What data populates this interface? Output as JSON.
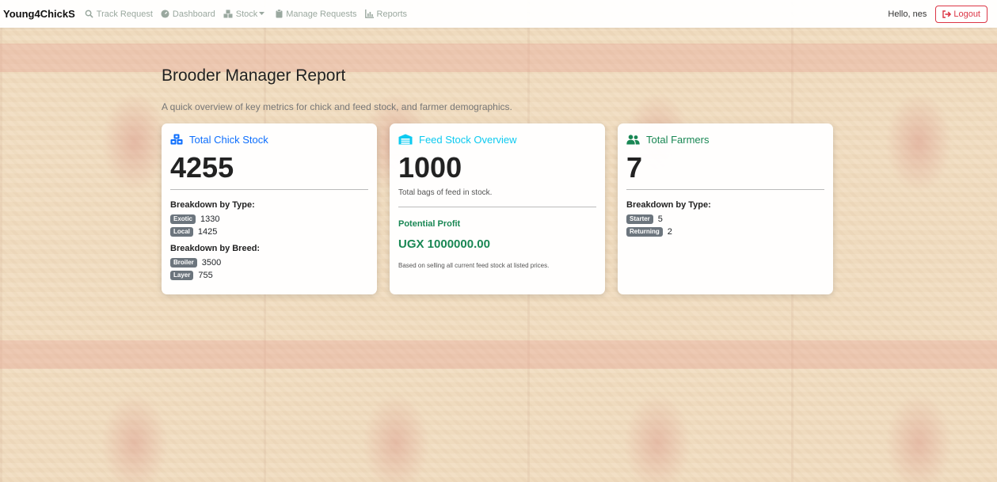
{
  "nav": {
    "brand": "Young4ChickS",
    "items": [
      {
        "label": "Track Request",
        "icon": "search-icon"
      },
      {
        "label": "Dashboard",
        "icon": "dashboard-icon"
      },
      {
        "label": "Stock",
        "icon": "boxes-icon"
      },
      {
        "label": "Manage Requests",
        "icon": "clipboard-icon"
      },
      {
        "label": "Reports",
        "icon": "chart-icon"
      }
    ],
    "greeting": "Hello, nes",
    "logout_label": "Logout"
  },
  "header": {
    "title": "Brooder Manager Report",
    "subtitle": "A quick overview of key metrics for chick and feed stock, and farmer demographics."
  },
  "colors": {
    "blue": "#0d6efd",
    "cyan": "#0dcaf0",
    "green": "#198754",
    "danger": "#dc3545",
    "badge": "#6c757d"
  },
  "cards": {
    "chick": {
      "title": "Total Chick Stock",
      "icon": "cubes-icon",
      "value": "4255",
      "type_label": "Breakdown by Type:",
      "types": [
        {
          "badge": "Exotic",
          "value": "1330"
        },
        {
          "badge": "Local",
          "value": "1425"
        }
      ],
      "breed_label": "Breakdown by Breed:",
      "breeds": [
        {
          "badge": "Broiler",
          "value": "3500"
        },
        {
          "badge": "Layer",
          "value": "755"
        }
      ]
    },
    "feed": {
      "title": "Feed Stock Overview",
      "icon": "warehouse-icon",
      "value": "1000",
      "note": "Total bags of feed in stock.",
      "profit_label": "Potential Profit",
      "profit_value": "UGX 1000000.00",
      "profit_note": "Based on selling all current feed stock at listed prices."
    },
    "farmers": {
      "title": "Total Farmers",
      "icon": "users-icon",
      "value": "7",
      "type_label": "Breakdown by Type:",
      "types": [
        {
          "badge": "Starter",
          "value": "5"
        },
        {
          "badge": "Returning",
          "value": "2"
        }
      ]
    }
  }
}
